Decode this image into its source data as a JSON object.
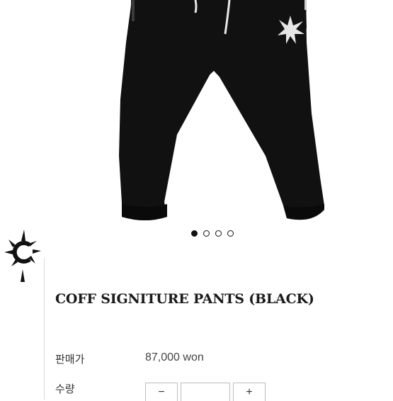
{
  "product": {
    "title": "COFF SIGNITURE PANTS (BLACK)",
    "image_alt": "black sweatpants with white drawstrings and star logo",
    "carousel": {
      "total": 4,
      "active": 1
    }
  },
  "details": {
    "price_label": "판매가",
    "price_value": "87,000 won",
    "qty_label": "수량",
    "qty_value": "",
    "qty_minus": "−",
    "qty_plus": "+"
  },
  "colors": {
    "pants": "#111111",
    "accent": "#111111"
  },
  "icons": {
    "logo": "spiky-star-logo"
  }
}
